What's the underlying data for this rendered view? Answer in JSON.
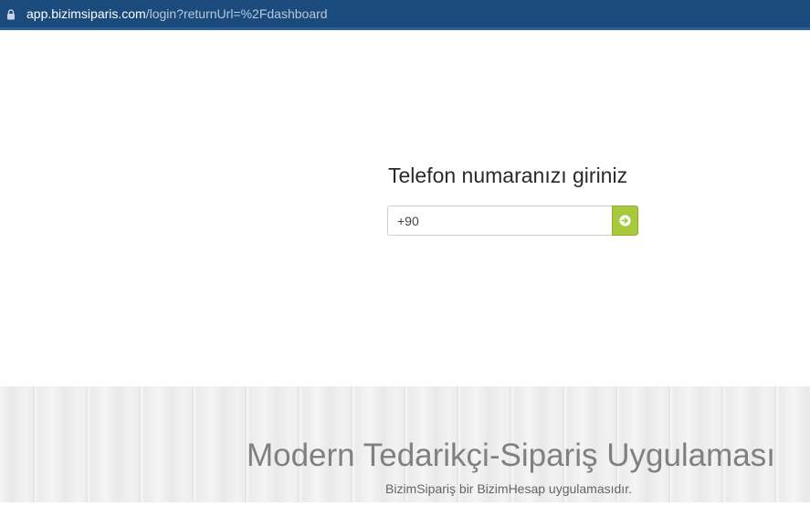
{
  "browser": {
    "url_host": "app.bizimsiparis.com",
    "url_path": "/login?returnUrl=%2Fdashboard",
    "icon": "lock-icon"
  },
  "login": {
    "prompt": "Telefon numaranızı giriniz",
    "phone_value": "+90",
    "submit_icon": "arrow-right-circle-icon"
  },
  "hero": {
    "title": "Modern Tedarikçi-Sipariş Uygulaması",
    "subtitle": "BizimSipariş bir BizimHesap uygulamasıdır."
  },
  "colors": {
    "browser_bar": "#1b4a7c",
    "accent": "#a8c93c",
    "hero_text": "#808080"
  }
}
